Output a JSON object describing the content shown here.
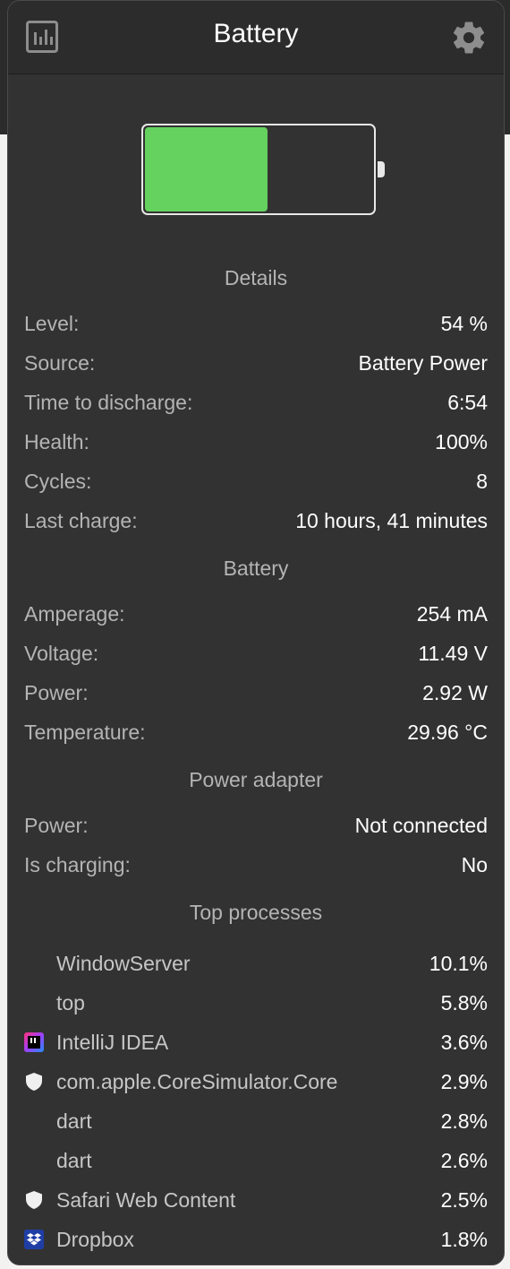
{
  "header": {
    "title": "Battery"
  },
  "battery": {
    "level_fraction": 0.54,
    "fill_color": "#65d15f"
  },
  "details": {
    "title": "Details",
    "rows": [
      {
        "label": "Level:",
        "value": "54 %"
      },
      {
        "label": "Source:",
        "value": "Battery Power"
      },
      {
        "label": "Time to discharge:",
        "value": "6:54"
      },
      {
        "label": "Health:",
        "value": "100%"
      },
      {
        "label": "Cycles:",
        "value": "8"
      },
      {
        "label": "Last charge:",
        "value": "10 hours, 41 minutes"
      }
    ]
  },
  "battery_section": {
    "title": "Battery",
    "rows": [
      {
        "label": "Amperage:",
        "value": "254 mA"
      },
      {
        "label": "Voltage:",
        "value": "11.49 V"
      },
      {
        "label": "Power:",
        "value": "2.92 W"
      },
      {
        "label": "Temperature:",
        "value": "29.96 °C"
      }
    ]
  },
  "power_adapter": {
    "title": "Power adapter",
    "rows": [
      {
        "label": "Power:",
        "value": "Not connected"
      },
      {
        "label": "Is charging:",
        "value": "No"
      }
    ]
  },
  "top_processes": {
    "title": "Top processes",
    "items": [
      {
        "name": "WindowServer",
        "value": "10.1%",
        "icon": "none"
      },
      {
        "name": "top",
        "value": "5.8%",
        "icon": "none"
      },
      {
        "name": "IntelliJ IDEA",
        "value": "3.6%",
        "icon": "intellij-icon"
      },
      {
        "name": "com.apple.CoreSimulator.Core",
        "value": "2.9%",
        "icon": "shield-icon"
      },
      {
        "name": "dart",
        "value": "2.8%",
        "icon": "none"
      },
      {
        "name": "dart",
        "value": "2.6%",
        "icon": "none"
      },
      {
        "name": "Safari Web Content",
        "value": "2.5%",
        "icon": "shield-icon"
      },
      {
        "name": "Dropbox",
        "value": "1.8%",
        "icon": "dropbox-icon"
      }
    ]
  }
}
